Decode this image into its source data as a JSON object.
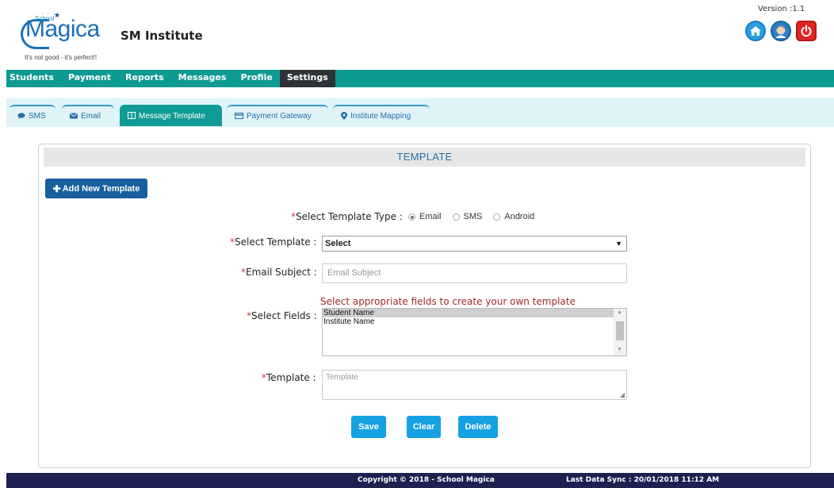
{
  "header": {
    "logo": {
      "small": "School",
      "word": "Magica",
      "tagline": "It's not good - it's perfect!!"
    },
    "institute_name": "SM Institute",
    "version": "Version :1.1",
    "icons": [
      "home-icon",
      "user-icon",
      "power-icon"
    ],
    "colors": {
      "home": "#2a9ee0",
      "user": "#2a7fc8",
      "power": "#e02424"
    }
  },
  "nav": {
    "items": [
      {
        "label": "Students"
      },
      {
        "label": "Payment"
      },
      {
        "label": "Reports"
      },
      {
        "label": "Messages"
      },
      {
        "label": "Profile"
      },
      {
        "label": "Settings",
        "active": true
      }
    ],
    "color": "#0d9a93"
  },
  "tabs": [
    {
      "label": "SMS",
      "icon": "chat-bubble-icon"
    },
    {
      "label": "Email",
      "icon": "envelope-icon"
    },
    {
      "label": "Message Template",
      "icon": "columns-icon",
      "active": true
    },
    {
      "label": "Payment Gateway",
      "icon": "credit-card-icon"
    },
    {
      "label": "Institute Mapping",
      "icon": "map-marker-icon"
    }
  ],
  "panel": {
    "title": "TEMPLATE",
    "add_button": "Add New Template",
    "template_type": {
      "label": "Select Template Type :",
      "options": [
        "Email",
        "SMS",
        "Android"
      ],
      "selected": "Email"
    },
    "select_template": {
      "label": "Select Template :",
      "value": "Select"
    },
    "email_subject": {
      "label": "Email Subject :",
      "placeholder": "Email Subject",
      "value": ""
    },
    "fields_hint": "Select appropriate fields to create your own template",
    "select_fields": {
      "label": "Select Fields :",
      "options": [
        "Student Name",
        "Institute Name"
      ],
      "selected": "Student Name"
    },
    "template": {
      "label": "Template :",
      "placeholder": "Template",
      "value": ""
    },
    "required_mark": "*",
    "buttons": {
      "save": "Save",
      "clear": "Clear",
      "delete": "Delete"
    }
  },
  "footer": {
    "copyright": "Copyright © 2018 - School Magica",
    "sync": "Last Data Sync : 20/01/2018 11:12 AM"
  }
}
